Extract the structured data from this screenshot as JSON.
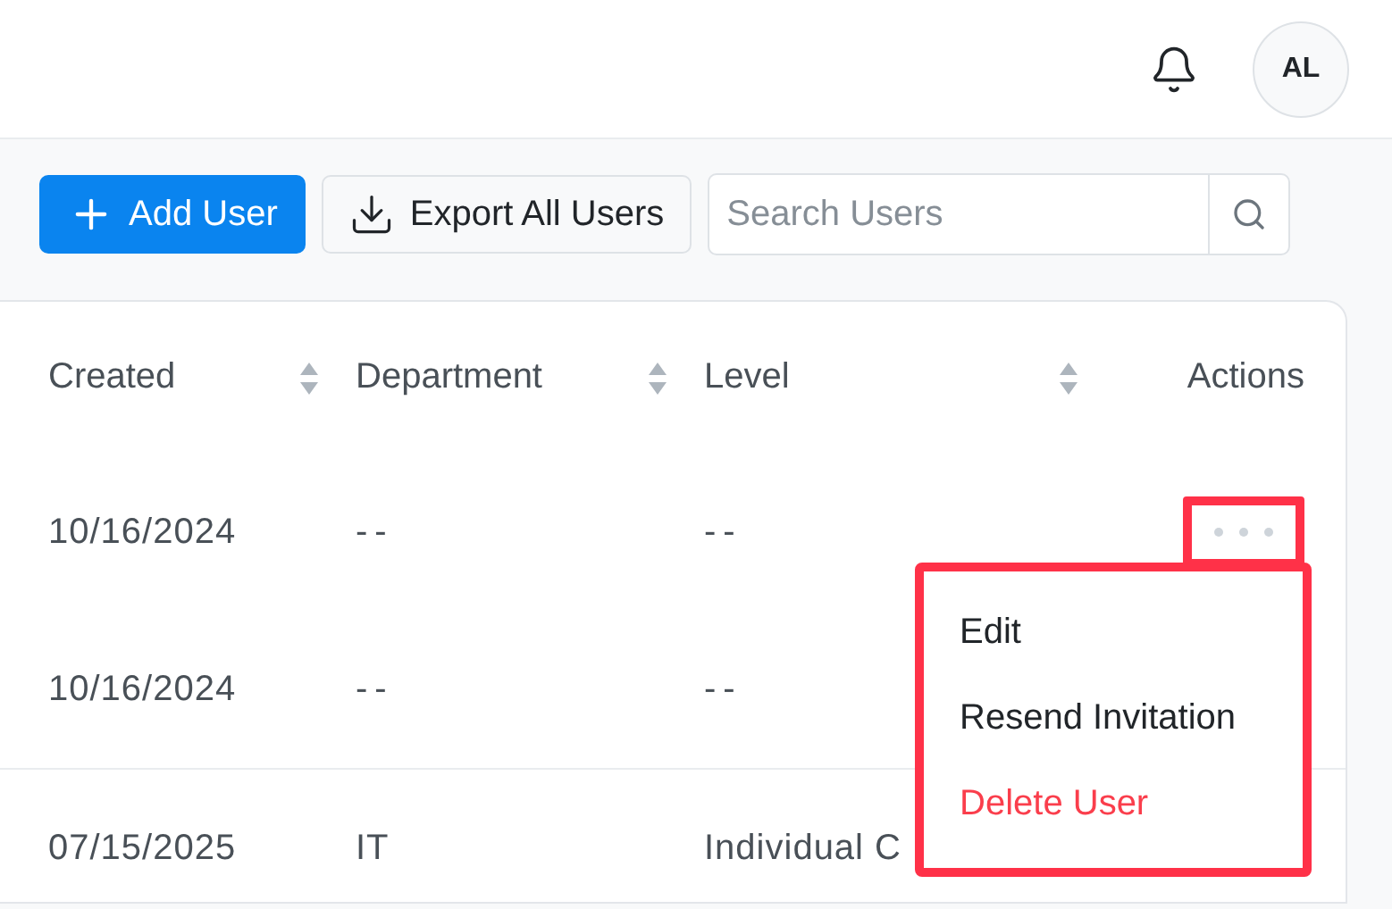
{
  "header": {
    "avatar": "AL"
  },
  "toolbar": {
    "add_button": "Add User",
    "export_button": "Export All Users",
    "search": {
      "placeholder": "Search Users"
    }
  },
  "table": {
    "columns": [
      {
        "label": "Created",
        "sortable": true
      },
      {
        "label": "Department",
        "sortable": true
      },
      {
        "label": "Level",
        "sortable": true
      },
      {
        "label": "Actions",
        "sortable": false
      }
    ],
    "groups": [
      {
        "rows": [
          {
            "cells": [
              "10/16/2024",
              "--",
              "--"
            ],
            "menu_open": true
          },
          {
            "cells": [
              "10/16/2024",
              "--",
              "--"
            ],
            "menu_open": false
          }
        ]
      },
      {
        "rows": [
          {
            "cells": [
              "07/15/2025",
              "IT",
              "Individual C"
            ],
            "menu_open": false
          }
        ]
      }
    ]
  },
  "actions_menu": {
    "items": [
      {
        "label": "Edit",
        "kind": "normal"
      },
      {
        "label": "Resend Invitation",
        "kind": "normal"
      },
      {
        "label": "Delete User",
        "kind": "danger"
      }
    ]
  }
}
